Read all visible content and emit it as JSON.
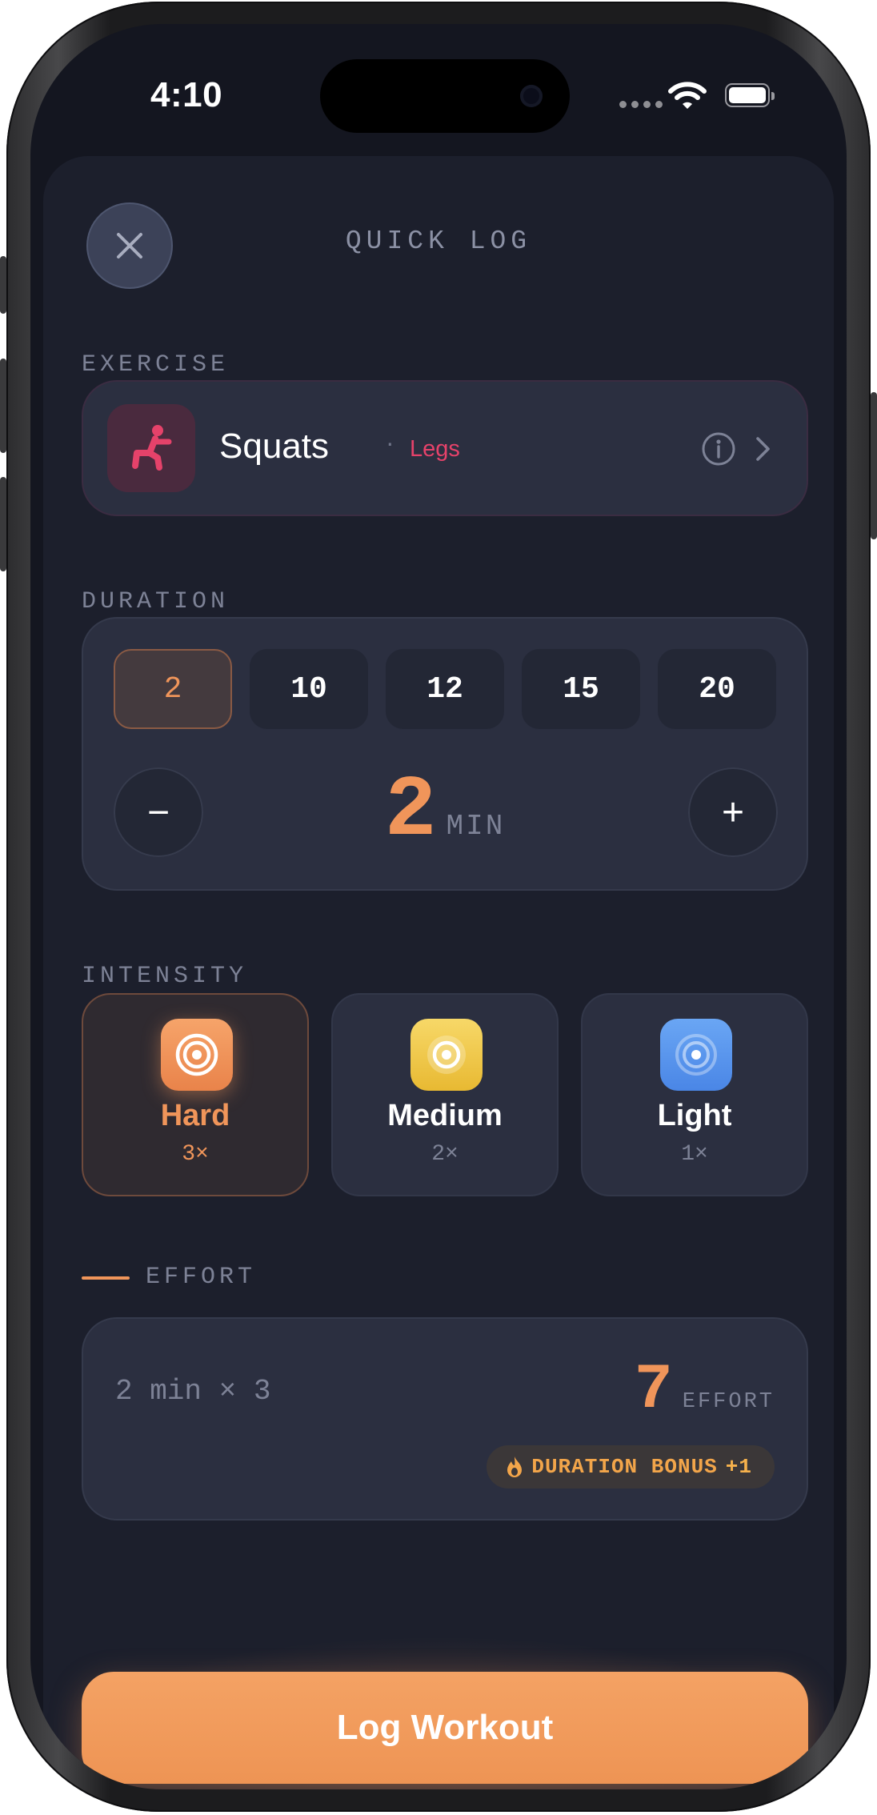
{
  "status_bar": {
    "time": "4:10"
  },
  "sheet": {
    "title": "QUICK LOG"
  },
  "exercise": {
    "section_label": "EXERCISE",
    "name": "Squats",
    "separator": "·",
    "group": "Legs",
    "icon": "squat-figure-icon"
  },
  "duration": {
    "section_label": "DURATION",
    "presets": [
      "2",
      "10",
      "12",
      "15",
      "20"
    ],
    "selected_index": 0,
    "decrement_label": "−",
    "increment_label": "+",
    "value": "2",
    "unit": "MIN"
  },
  "intensity": {
    "section_label": "INTENSITY",
    "options": [
      {
        "name": "Hard",
        "multiplier": "3×",
        "color": "#f0955a",
        "selected": true
      },
      {
        "name": "Medium",
        "multiplier": "2×",
        "color": "#f1c544",
        "selected": false
      },
      {
        "name": "Light",
        "multiplier": "1×",
        "color": "#5b98f0",
        "selected": false
      }
    ]
  },
  "effort": {
    "section_label": "EFFORT",
    "formula": "2 min × 3",
    "value": "7",
    "unit": "EFFORT",
    "bonus_label": "DURATION BONUS",
    "bonus_value": "+1"
  },
  "action": {
    "log_label": "Log Workout"
  },
  "colors": {
    "accent": "#f0955a",
    "legs": "#e5426a",
    "background": "#1c1f2c"
  }
}
